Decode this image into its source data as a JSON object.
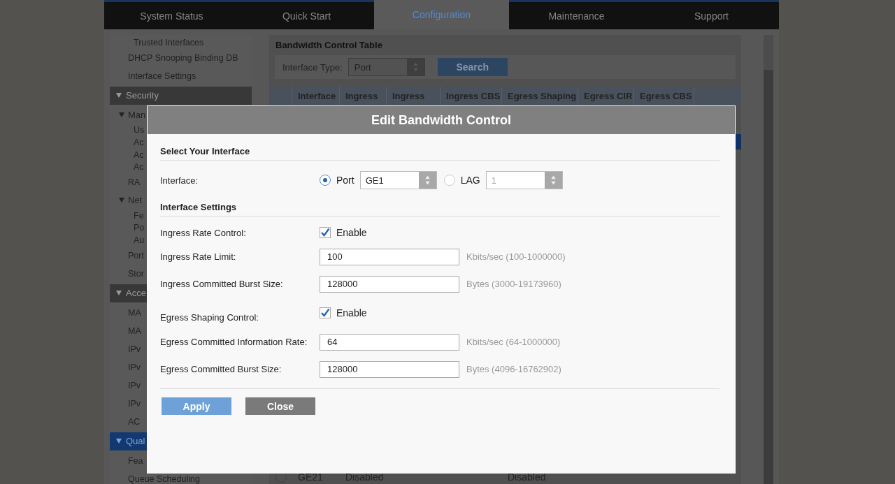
{
  "nav": {
    "tabs": [
      {
        "label": "System Status",
        "selected": false
      },
      {
        "label": "Quick Start",
        "selected": false
      },
      {
        "label": "Configuration",
        "selected": true
      },
      {
        "label": "Maintenance",
        "selected": false
      },
      {
        "label": "Support",
        "selected": false
      }
    ]
  },
  "sidebar": {
    "items": [
      {
        "children": [
          {
            "label": "Trusted Interfaces"
          }
        ]
      },
      {
        "label": "DHCP Snooping Binding DB"
      },
      {
        "label": "Interface Settings"
      },
      {
        "label": "Security",
        "kind": "section",
        "expanded": true,
        "selected": false,
        "children": [
          {
            "label": "Man",
            "expanded": true,
            "children": [
              {
                "label": "Us"
              },
              {
                "label": "Ac"
              },
              {
                "label": "Ac"
              },
              {
                "label": "Ac"
              }
            ]
          },
          {
            "label": "RA"
          },
          {
            "label": "Net",
            "expanded": true,
            "children": [
              {
                "label": "Fe"
              },
              {
                "label": "Po"
              },
              {
                "label": "Au"
              }
            ]
          },
          {
            "label": "Port"
          },
          {
            "label": "Stor"
          }
        ]
      },
      {
        "label": "Acce",
        "kind": "section",
        "expanded": true,
        "selected": false,
        "children": [
          {
            "label": "MA"
          },
          {
            "label": "MA"
          },
          {
            "label": "IPv"
          },
          {
            "label": "IPv"
          },
          {
            "label": "IPv"
          },
          {
            "label": "IPv"
          },
          {
            "label": "AC"
          }
        ]
      },
      {
        "label": "Qual",
        "kind": "section",
        "expanded": true,
        "selected": true,
        "children": [
          {
            "label": "Fea"
          },
          {
            "label": "Queue Scheduling"
          }
        ]
      }
    ]
  },
  "main": {
    "title": "Bandwidth Control Table",
    "filter": {
      "label": "Interface Type:",
      "value": "Port",
      "button": "Search"
    },
    "table": {
      "columns": [
        "Interface",
        "Ingress",
        "Ingress",
        "Ingress CBS",
        "Egress Shaping",
        "Egress CIR",
        "Egress CBS"
      ],
      "rows": [
        {
          "selected": true
        },
        {
          "selected": false,
          "cells": [
            "GE21",
            "Disabled",
            "",
            "",
            "Disabled"
          ]
        }
      ]
    }
  },
  "dialog": {
    "title": "Edit Bandwidth Control",
    "interface_section": "Select Your Interface",
    "interface_label": "Interface:",
    "interface_options": [
      {
        "label": "Port",
        "selected": true,
        "value": "GE1",
        "disabled": false
      },
      {
        "label": "LAG",
        "selected": false,
        "value": "1",
        "disabled": true
      }
    ],
    "settings_section": "Interface Settings",
    "fields": [
      {
        "kind": "checkbox",
        "label": "Ingress Rate Control:",
        "checked": true,
        "option": "Enable"
      },
      {
        "kind": "input",
        "label": "Ingress Rate Limit:",
        "value": "100",
        "hint": "Kbits/sec (100-1000000)"
      },
      {
        "kind": "input",
        "label": "Ingress Committed Burst Size:",
        "value": "128000",
        "hint": "Bytes (3000-19173960)"
      },
      {
        "kind": "checkbox",
        "label": "Egress Shaping Control:",
        "checked": true,
        "option": "Enable"
      },
      {
        "kind": "input",
        "label": "Egress Committed Information Rate:",
        "value": "64",
        "hint": "Kbits/sec (64-1000000)"
      },
      {
        "kind": "input",
        "label": "Egress Committed Burst Size:",
        "value": "128000",
        "hint": "Bytes (4096-16762902)"
      }
    ],
    "buttons": [
      {
        "label": "Apply",
        "kind": "primary"
      },
      {
        "label": "Close",
        "kind": "secondary"
      }
    ]
  }
}
